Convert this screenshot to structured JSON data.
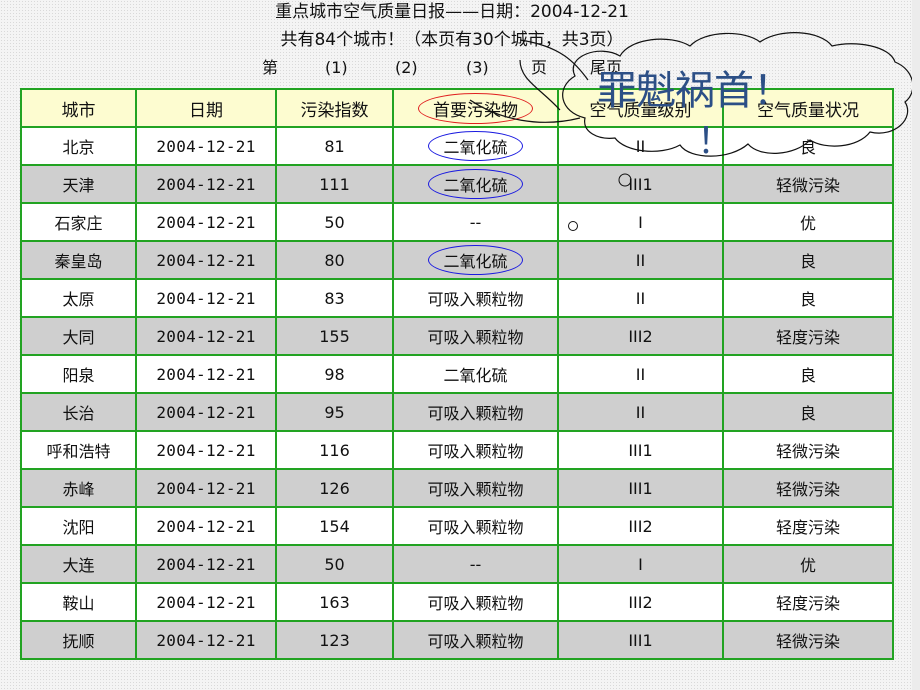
{
  "header": {
    "title": "重点城市空气质量日报——日期：2004-12-21",
    "subtitle": "共有84个城市！（本页有30个城市，共3页）",
    "pager": {
      "prefix": "第",
      "pages": [
        "(1)",
        "(2)",
        "(3)"
      ],
      "suffix": "页",
      "last": "尾页"
    }
  },
  "annotation": {
    "bubble_text": "罪魁祸首！",
    "bubble_excl": "！"
  },
  "table": {
    "columns": [
      "城市",
      "日期",
      "污染指数",
      "首要污染物",
      "空气质量级别",
      "空气质量状况"
    ],
    "rows": [
      {
        "city": "北京",
        "date": "2004-12-21",
        "index": "81",
        "pollutant": "二氧化硫",
        "level": "II",
        "status": "良"
      },
      {
        "city": "天津",
        "date": "2004-12-21",
        "index": "111",
        "pollutant": "二氧化硫",
        "level": "III1",
        "status": "轻微污染"
      },
      {
        "city": "石家庄",
        "date": "2004-12-21",
        "index": "50",
        "pollutant": "--",
        "level": "I",
        "status": "优"
      },
      {
        "city": "秦皇岛",
        "date": "2004-12-21",
        "index": "80",
        "pollutant": "二氧化硫",
        "level": "II",
        "status": "良"
      },
      {
        "city": "太原",
        "date": "2004-12-21",
        "index": "83",
        "pollutant": "可吸入颗粒物",
        "level": "II",
        "status": "良"
      },
      {
        "city": "大同",
        "date": "2004-12-21",
        "index": "155",
        "pollutant": "可吸入颗粒物",
        "level": "III2",
        "status": "轻度污染"
      },
      {
        "city": "阳泉",
        "date": "2004-12-21",
        "index": "98",
        "pollutant": "二氧化硫",
        "level": "II",
        "status": "良"
      },
      {
        "city": "长治",
        "date": "2004-12-21",
        "index": "95",
        "pollutant": "可吸入颗粒物",
        "level": "II",
        "status": "良"
      },
      {
        "city": "呼和浩特",
        "date": "2004-12-21",
        "index": "116",
        "pollutant": "可吸入颗粒物",
        "level": "III1",
        "status": "轻微污染"
      },
      {
        "city": "赤峰",
        "date": "2004-12-21",
        "index": "126",
        "pollutant": "可吸入颗粒物",
        "level": "III1",
        "status": "轻微污染"
      },
      {
        "city": "沈阳",
        "date": "2004-12-21",
        "index": "154",
        "pollutant": "可吸入颗粒物",
        "level": "III2",
        "status": "轻度污染"
      },
      {
        "city": "大连",
        "date": "2004-12-21",
        "index": "50",
        "pollutant": "--",
        "level": "I",
        "status": "优"
      },
      {
        "city": "鞍山",
        "date": "2004-12-21",
        "index": "163",
        "pollutant": "可吸入颗粒物",
        "level": "III2",
        "status": "轻度污染"
      },
      {
        "city": "抚顺",
        "date": "2004-12-21",
        "index": "123",
        "pollutant": "可吸入颗粒物",
        "level": "III1",
        "status": "轻微污染"
      }
    ]
  },
  "colors": {
    "grid": "#22a322",
    "header_bg": "#fdfcd0",
    "alt_row_bg": "#cfcfcf",
    "highlight_blue": "#1b1be0",
    "highlight_red": "#e02020",
    "annotation_text": "#2c4f86"
  }
}
